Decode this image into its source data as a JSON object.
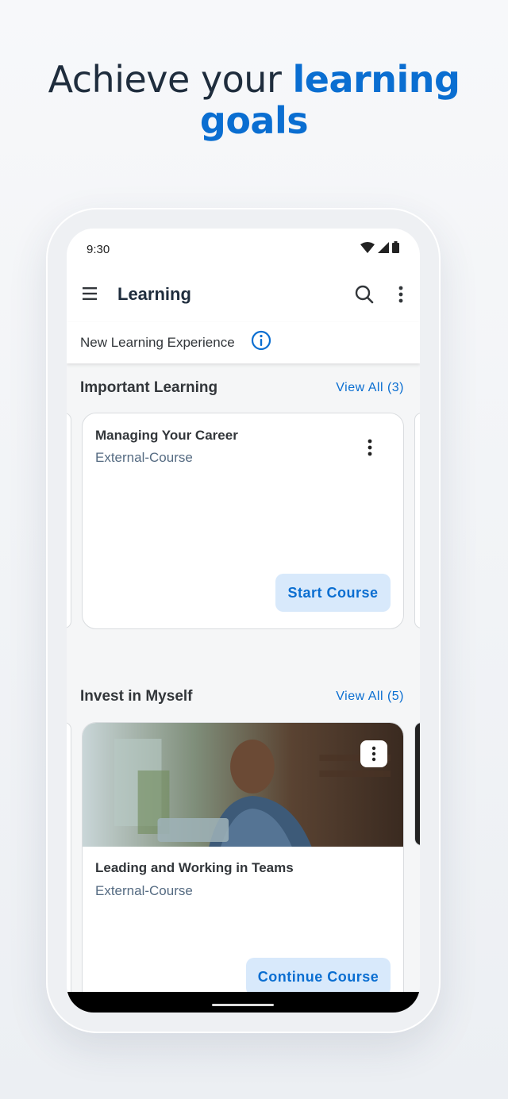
{
  "headline": {
    "part1": "Achieve your ",
    "accent": "learning",
    "part2": "goals"
  },
  "status_bar": {
    "time": "9:30"
  },
  "app_bar": {
    "title": "Learning"
  },
  "sub_bar": {
    "text": "New Learning Experience"
  },
  "sections": [
    {
      "title": "Important Learning",
      "view_all": "View All (3)",
      "card": {
        "title": "Managing Your Career",
        "subtitle": "External-Course",
        "button": "Start Course"
      }
    },
    {
      "title": "Invest in Myself",
      "view_all": "View All (5)",
      "card": {
        "title": "Leading and Working in Teams",
        "subtitle": "External-Course",
        "button": "Continue Course"
      }
    }
  ],
  "colors": {
    "accent": "#0a6ed1",
    "button_bg": "#d8e9fb",
    "title_text": "#1f2d3d"
  },
  "icons": [
    "menu-icon",
    "search-icon",
    "more-vertical-icon",
    "info-icon",
    "wifi-icon",
    "signal-icon",
    "battery-icon"
  ]
}
